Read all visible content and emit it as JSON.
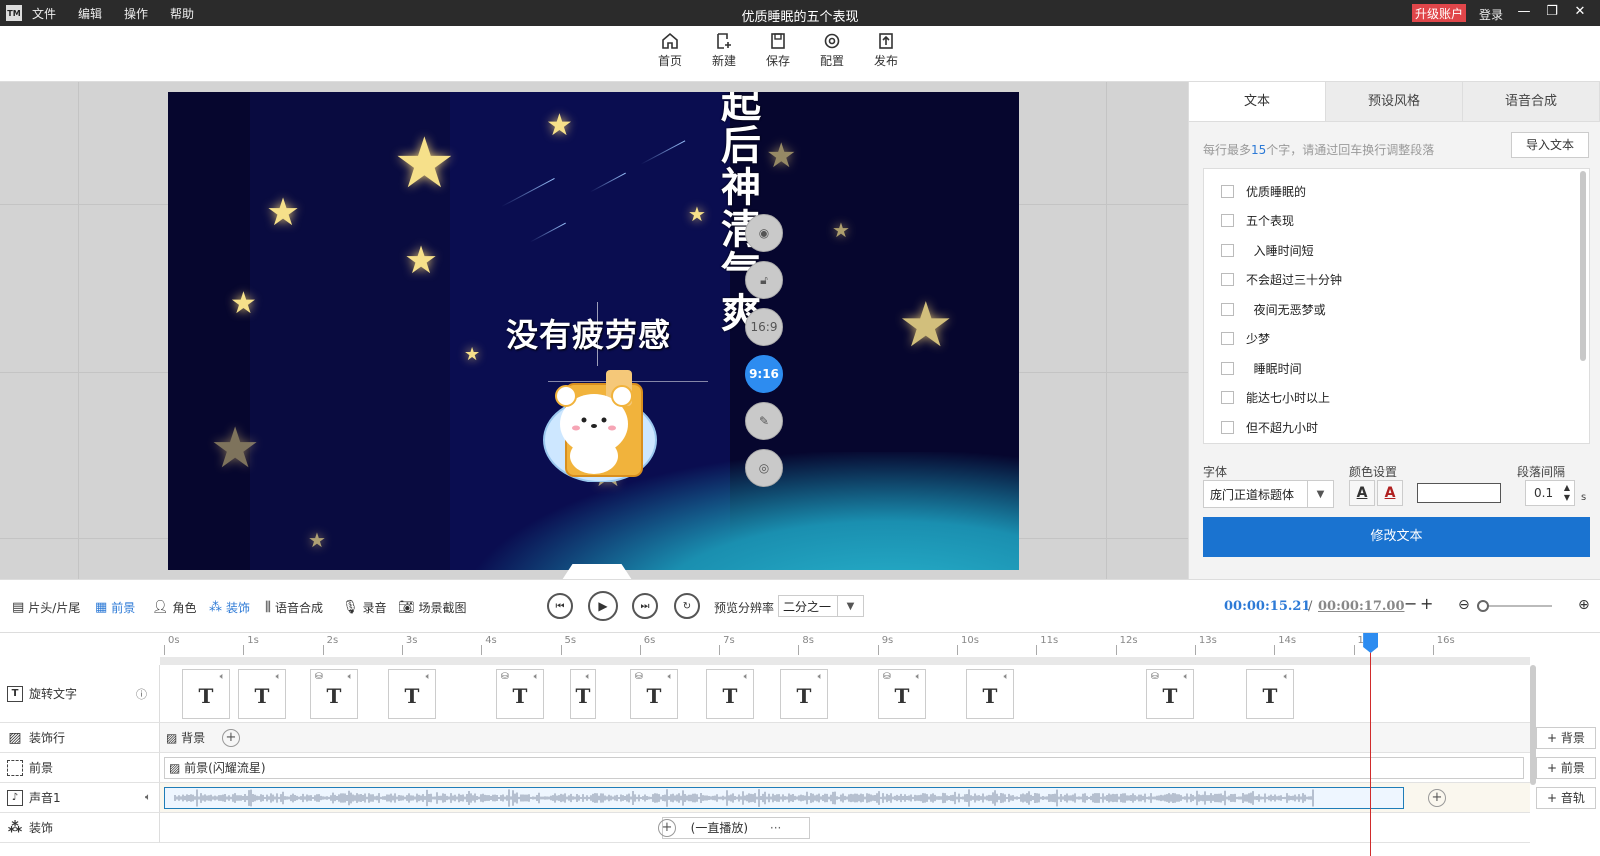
{
  "window": {
    "logo": "TM",
    "menus": [
      "文件",
      "编辑",
      "操作",
      "帮助"
    ],
    "title": "优质睡眠的五个表现",
    "upgrade": "升级账户",
    "login": "登录"
  },
  "toolbar": {
    "home": "首页",
    "new": "新建",
    "save": "保存",
    "config": "配置",
    "publish": "发布"
  },
  "canvas": {
    "vertical_text": "起后神清气爽",
    "center_text": "没有疲劳感",
    "side_buttons": {
      "ratio_169": "16:9",
      "ratio_916": "9:16"
    }
  },
  "right_panel": {
    "tabs": [
      "文本",
      "预设风格",
      "语音合成"
    ],
    "hint_prefix": "每行最多",
    "hint_num": "15",
    "hint_suffix": "个字，请通过回车换行调整段落",
    "import_btn": "导入文本",
    "lines": [
      "优质睡眠的",
      "五个表现",
      "  入睡时间短",
      "不会超过三十分钟",
      "  夜间无恶梦或",
      "少梦",
      "  睡眠时间",
      "能达七小时以上",
      "但不超九小时"
    ],
    "font_label": "字体",
    "color_label": "颜色设置",
    "spacing_label": "段落间隔",
    "font_value": "庞门正道标题体",
    "spacing_value": "0.1",
    "spacing_unit": "s",
    "color_a": "A",
    "modify_btn": "修改文本"
  },
  "controls": {
    "head_tail": "片头/片尾",
    "foreground": "前景",
    "role": "角色",
    "decoration": "装饰",
    "tts": "语音合成",
    "record": "录音",
    "screenshot": "场景截图",
    "preview_label": "预览分辨率",
    "preview_value": "二分之一",
    "current_time": "00:00:15.21",
    "separator": "/",
    "total_time": "00:00:17.00",
    "minus": "−",
    "plus": "+"
  },
  "timeline": {
    "ticks": [
      "0s",
      "1s",
      "2s",
      "3s",
      "4s",
      "5s",
      "6s",
      "7s",
      "8s",
      "9s",
      "10s",
      "11s",
      "12s",
      "13s",
      "14s",
      "15s",
      "16s"
    ],
    "playhead_time": 15.21,
    "total_seconds": 17,
    "tracks": {
      "rotate_text": "旋转文字",
      "decoration_row": "装饰行",
      "foreground": "前景",
      "audio": "声音1",
      "decoration": "装饰"
    },
    "clip_glyph": "T",
    "bg_clip": "背景",
    "fg_clip": "前景(闪耀流星)",
    "deco_clip": "(一直播放)",
    "deco_dots": "···",
    "add_bg": "背景",
    "add_fg": "前景",
    "add_audio": "音轨"
  }
}
